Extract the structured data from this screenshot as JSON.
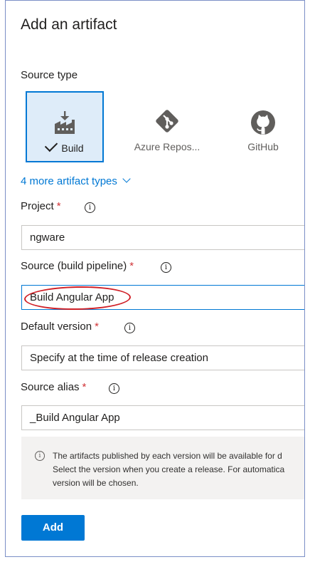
{
  "panel": {
    "title": "Add an artifact",
    "source_type_label": "Source type"
  },
  "source_types": [
    {
      "label": "Build",
      "icon": "build-factory-icon",
      "selected": true
    },
    {
      "label": "Azure Repos...",
      "icon": "git-diamond-icon",
      "selected": false
    },
    {
      "label": "GitHub",
      "icon": "github-octocat-icon",
      "selected": false
    }
  ],
  "more_types_link": "4 more artifact types",
  "project": {
    "label": "Project",
    "required_mark": "*",
    "value": "ngware"
  },
  "source": {
    "label": "Source (build pipeline)",
    "required_mark": "*",
    "value": "Build Angular App"
  },
  "default_version": {
    "label": "Default version",
    "required_mark": "*",
    "value": "Specify at the time of release creation"
  },
  "source_alias": {
    "label": "Source alias",
    "required_mark": "*",
    "value": "_Build Angular App"
  },
  "info_note": {
    "line1": "The artifacts published by each version will be available for d",
    "line2": "Select the version when you create a release. For automatica",
    "line3": "version will be chosen."
  },
  "add_button": "Add",
  "colors": {
    "accent": "#0078d4",
    "selected_tile_bg": "#deecf9",
    "required": "#d13438",
    "annotation": "#d01f26"
  }
}
